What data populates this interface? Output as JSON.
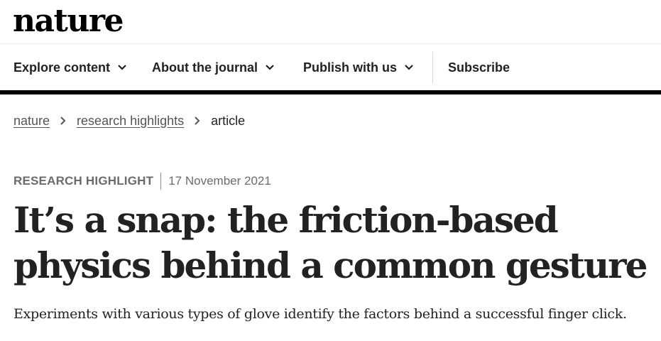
{
  "brand": {
    "logo_text": "nature"
  },
  "nav": {
    "items": [
      {
        "label": "Explore content",
        "has_dropdown": true
      },
      {
        "label": "About the journal",
        "has_dropdown": true
      },
      {
        "label": "Publish with us",
        "has_dropdown": true
      },
      {
        "label": "Subscribe",
        "has_dropdown": false
      }
    ]
  },
  "breadcrumb": {
    "items": [
      {
        "label": "nature"
      },
      {
        "label": "research highlights"
      },
      {
        "label": "article"
      }
    ]
  },
  "article": {
    "type": "RESEARCH HIGHLIGHT",
    "date": "17 November 2021",
    "title_line1": "It’s a snap: the friction-based",
    "title_line2": "physics behind a common gesture",
    "standfirst": "Experiments with various types of glove identify the factors behind a successful finger click."
  },
  "icons": {
    "dropdown": "chevron-down-icon",
    "breadcrumb_separator": "chevron-right-icon"
  }
}
